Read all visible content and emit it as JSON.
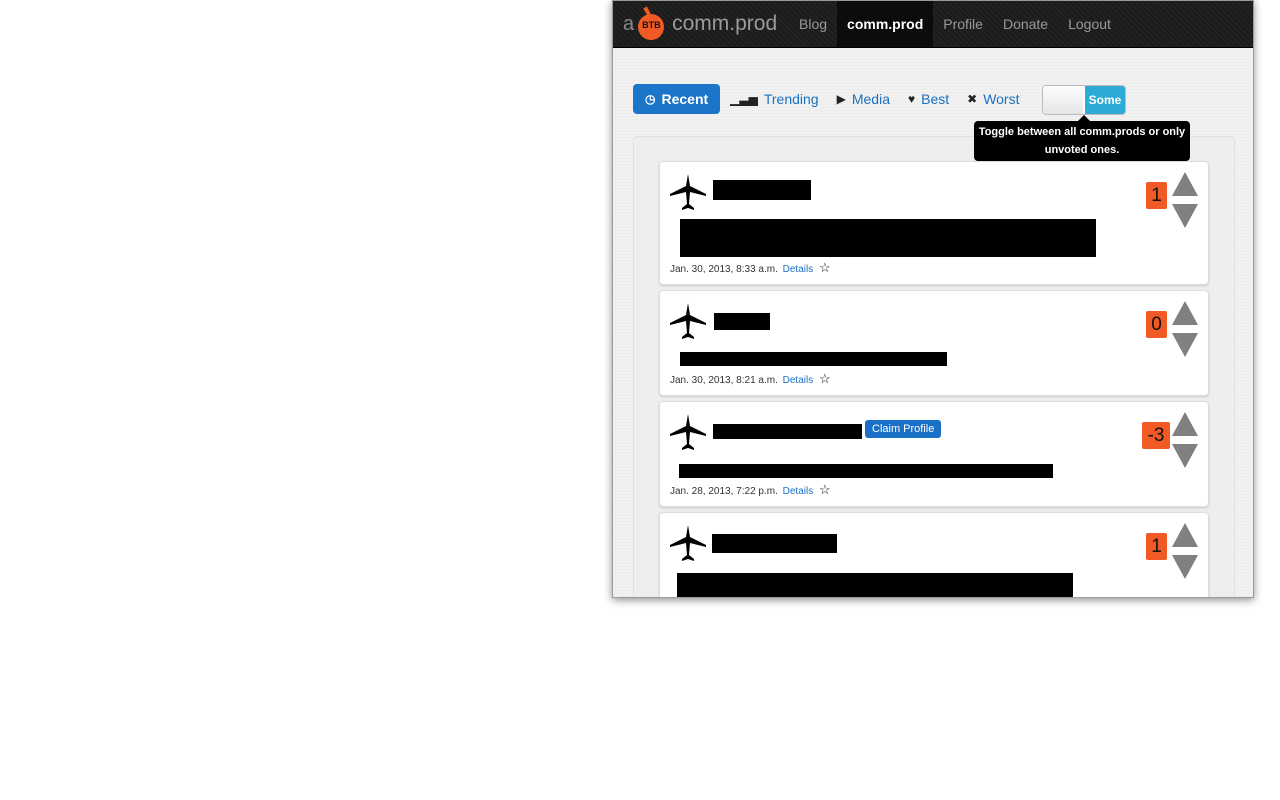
{
  "brand": {
    "prefix": "a",
    "badge": "BTB",
    "name": "comm.prod"
  },
  "nav": [
    {
      "label": "Blog",
      "active": false
    },
    {
      "label": "comm.prod",
      "active": true
    },
    {
      "label": "Profile",
      "active": false
    },
    {
      "label": "Donate",
      "active": false
    },
    {
      "label": "Logout",
      "active": false
    }
  ],
  "tabs": [
    {
      "label": "Recent",
      "icon": "clock-icon",
      "glyph": "◷",
      "active": true
    },
    {
      "label": "Trending",
      "icon": "signal-bars-icon",
      "glyph": "▁▃▅",
      "active": false
    },
    {
      "label": "Media",
      "icon": "play-icon",
      "glyph": "▶",
      "active": false
    },
    {
      "label": "Best",
      "icon": "heart-icon",
      "glyph": "♥",
      "active": false
    },
    {
      "label": "Worst",
      "icon": "x-icon",
      "glyph": "✖",
      "active": false
    }
  ],
  "toggle": {
    "on_label": "Some"
  },
  "tooltip": {
    "text": "Toggle between all comm.prods or only unvoted ones."
  },
  "posts": [
    {
      "date": "Jan. 30, 2013, 8:33 a.m.",
      "details": "Details",
      "score": "1",
      "claim": null
    },
    {
      "date": "Jan. 30, 2013, 8:21 a.m.",
      "details": "Details",
      "score": "0",
      "claim": null
    },
    {
      "date": "Jan. 28, 2013, 7:22 p.m.",
      "details": "Details",
      "score": "-3",
      "claim": "Claim Profile"
    },
    {
      "date": "",
      "details": "",
      "score": "1",
      "claim": null
    }
  ],
  "colors": {
    "accent": "#1b75c9",
    "score_bg": "#f15a24",
    "navbar": "#1b1b1b"
  }
}
